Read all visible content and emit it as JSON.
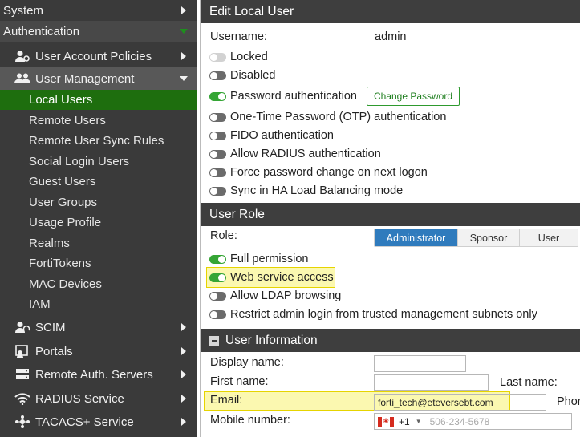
{
  "sidebar": {
    "system": "System",
    "authentication": "Authentication",
    "user_account_policies": "User Account Policies",
    "user_management": "User Management",
    "items": [
      {
        "label": "Local Users",
        "active": true
      },
      {
        "label": "Remote Users"
      },
      {
        "label": "Remote User Sync Rules"
      },
      {
        "label": "Social Login Users"
      },
      {
        "label": "Guest Users"
      },
      {
        "label": "User Groups"
      },
      {
        "label": "Usage Profile"
      },
      {
        "label": "Realms"
      },
      {
        "label": "FortiTokens"
      },
      {
        "label": "MAC Devices"
      },
      {
        "label": "IAM"
      }
    ],
    "scim": "SCIM",
    "portals": "Portals",
    "remote_auth": "Remote Auth. Servers",
    "radius": "RADIUS Service",
    "tacacs": "TACACS+ Service"
  },
  "edit": {
    "header": "Edit Local User",
    "username_label": "Username:",
    "username_value": "admin",
    "locked": "Locked",
    "disabled": "Disabled",
    "password_auth": "Password authentication",
    "change_password": "Change Password",
    "otp": "One-Time Password (OTP) authentication",
    "fido": "FIDO authentication",
    "radius_auth": "Allow RADIUS authentication",
    "force_change": "Force password change on next logon",
    "sync_ha": "Sync in HA Load Balancing mode"
  },
  "role": {
    "header": "User Role",
    "label": "Role:",
    "options": [
      "Administrator",
      "Sponsor",
      "User"
    ],
    "selected": "Administrator",
    "full_permission": "Full permission",
    "web_service": "Web service access",
    "ldap": "Allow LDAP browsing",
    "restrict": "Restrict admin login from trusted management subnets only"
  },
  "info": {
    "header": "User Information",
    "display_name": "Display name:",
    "first_name": "First name:",
    "last_name": "Last name:",
    "email": "Email:",
    "email_value": "forti_tech@eteversebt.com",
    "phone_label_partial": "Phon",
    "mobile": "Mobile number:",
    "country_code": "+1",
    "mobile_placeholder": "506-234-5678"
  },
  "colors": {
    "active_green": "#1e6e0e",
    "toggle_on": "#35a535",
    "segment_selected": "#2f7bbd",
    "highlight": "#fbf8b0"
  }
}
